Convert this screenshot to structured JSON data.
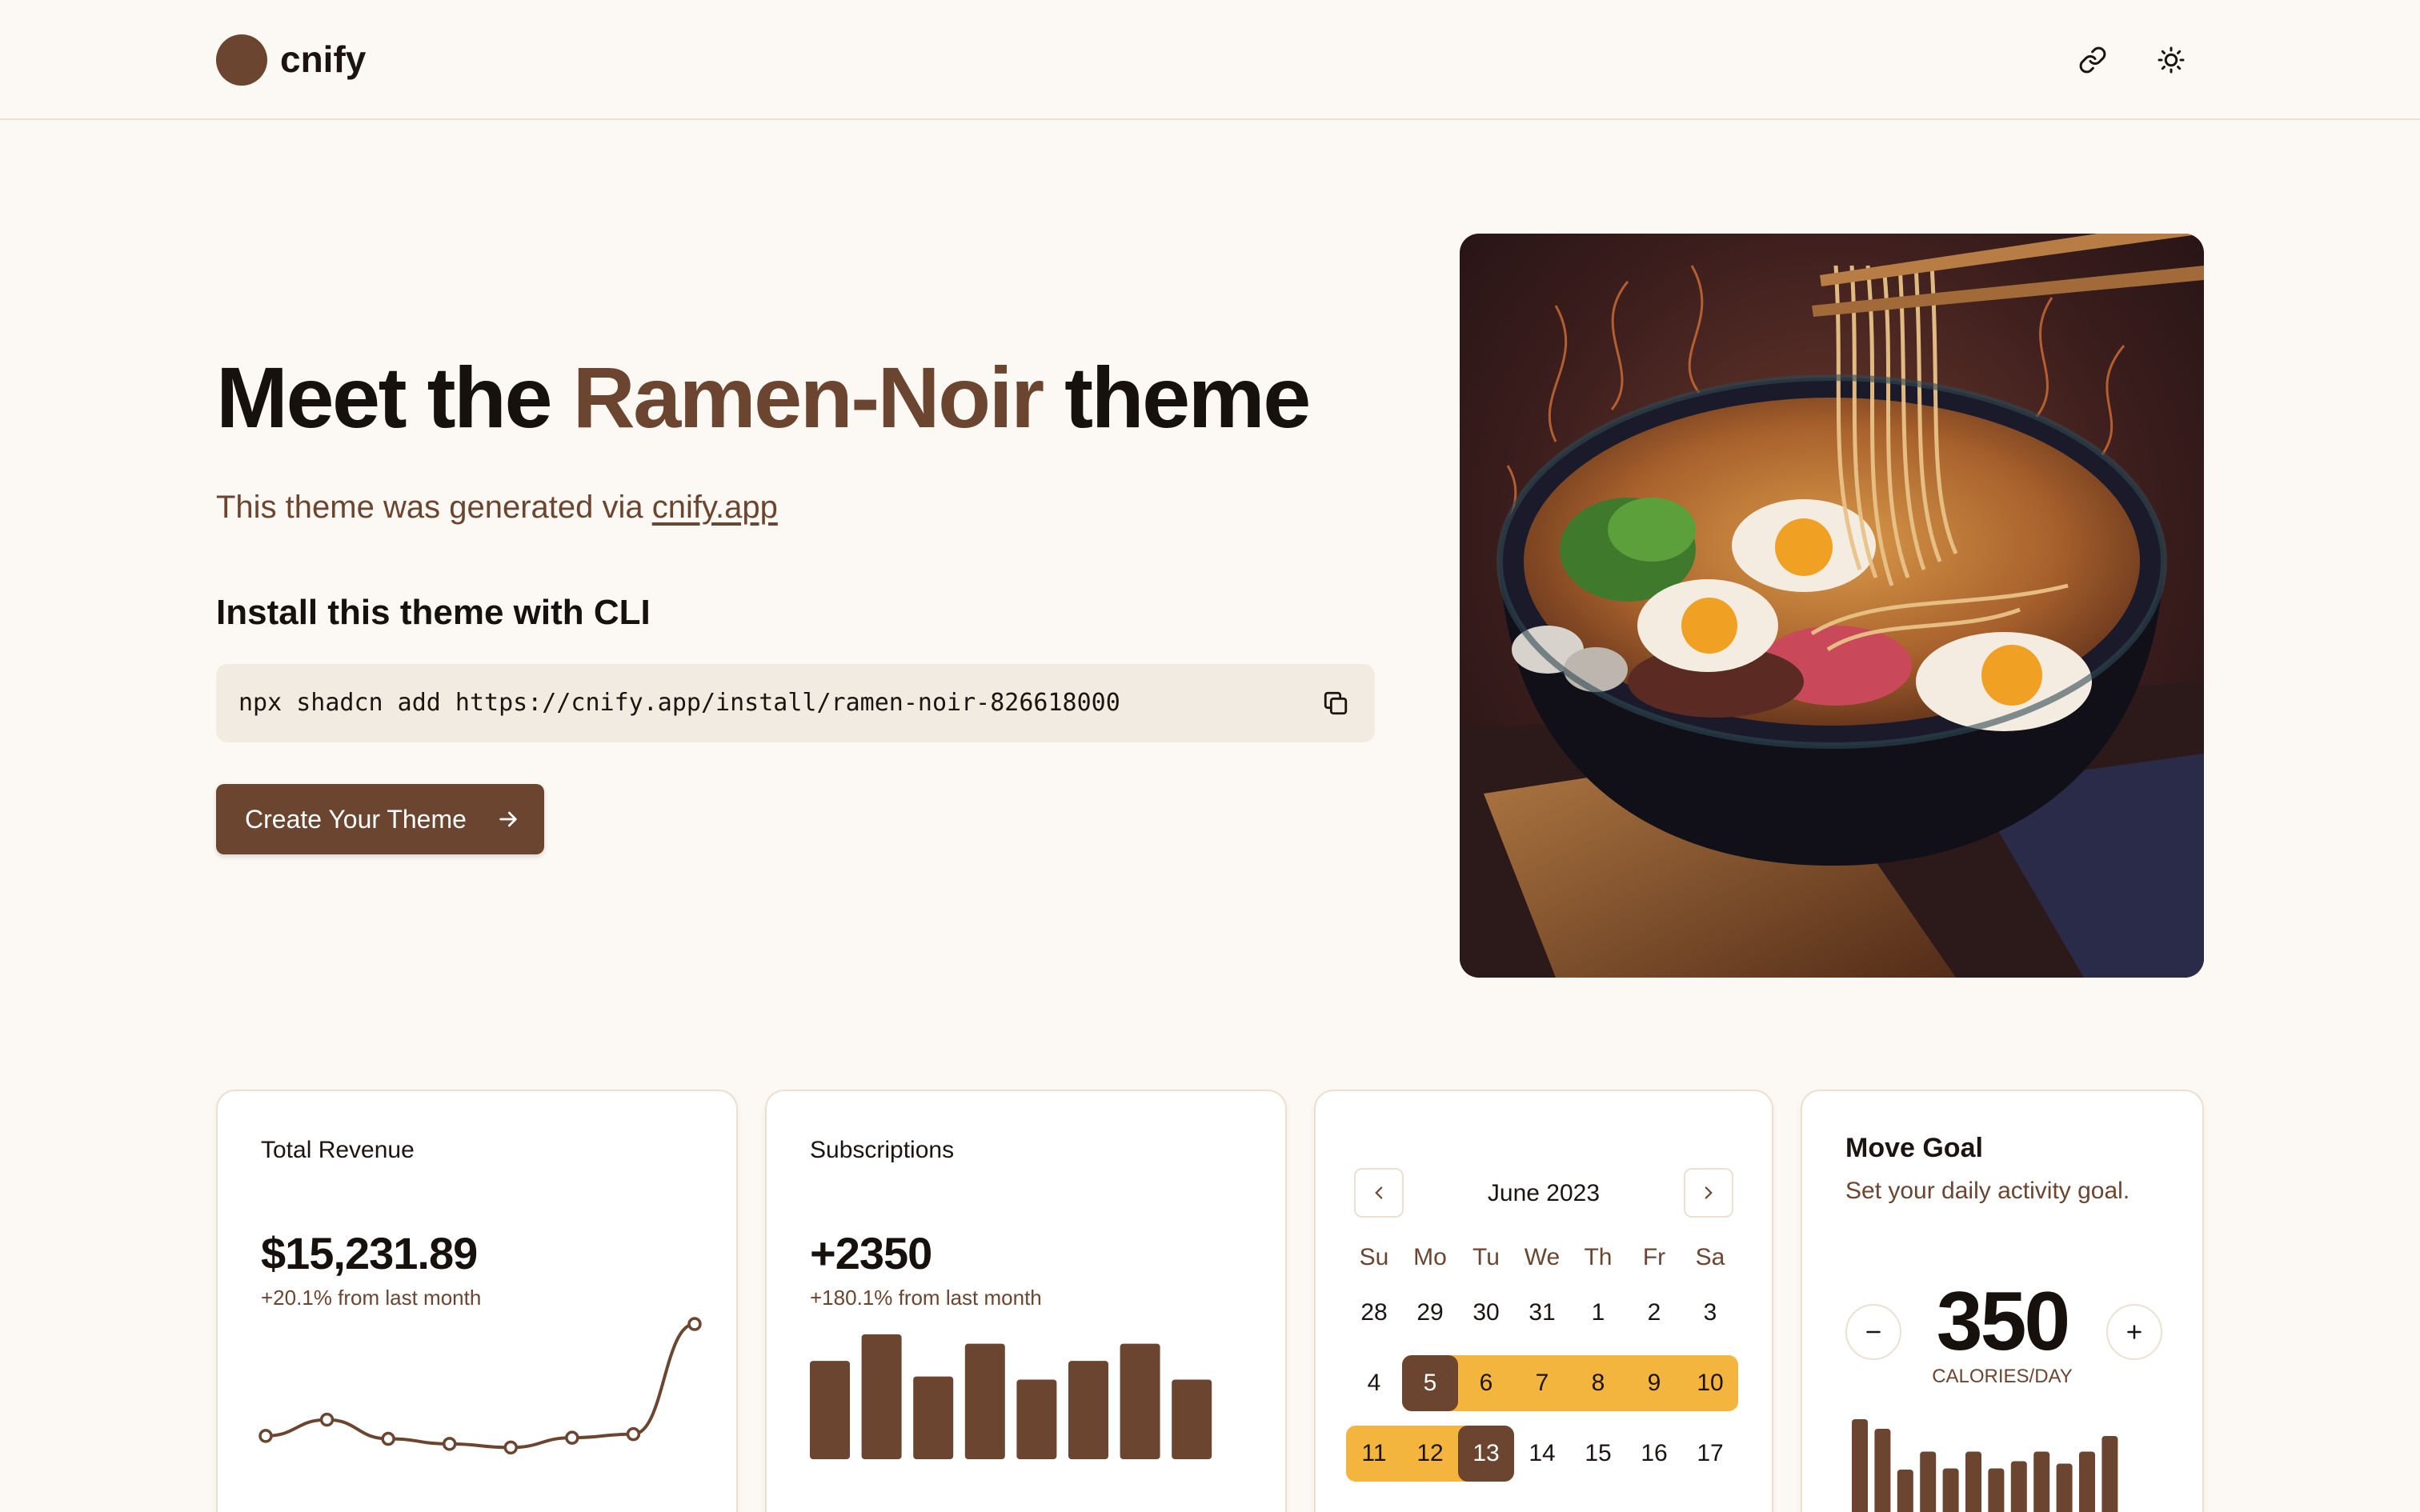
{
  "app": {
    "name": "cnify"
  },
  "header": {
    "link_icon": "link-icon",
    "theme_icon": "sun-icon"
  },
  "hero": {
    "title_prefix": "Meet the ",
    "title_accent": "Ramen-Noir",
    "title_suffix": " theme",
    "subtitle_prefix": "This theme was generated via ",
    "subtitle_link": "cnify.app",
    "install_title": "Install this theme with CLI",
    "command": "npx shadcn add https://cnify.app/install/ramen-noir-826618000",
    "cta_label": "Create Your Theme"
  },
  "colors": {
    "primary": "#6b4530",
    "accent": "#f4b53f",
    "background": "#fcf8f3"
  },
  "revenue": {
    "title": "Total Revenue",
    "value": "$15,231.89",
    "delta": "+20.1% from last month"
  },
  "subscriptions": {
    "title": "Subscriptions",
    "value": "+2350",
    "delta": "+180.1% from last month"
  },
  "calendar": {
    "month": "June 2023",
    "weekdays": [
      "Su",
      "Mo",
      "Tu",
      "We",
      "Th",
      "Fr",
      "Sa"
    ],
    "weeks": [
      [
        "28",
        "29",
        "30",
        "31",
        "1",
        "2",
        "3"
      ],
      [
        "4",
        "5",
        "6",
        "7",
        "8",
        "9",
        "10"
      ],
      [
        "11",
        "12",
        "13",
        "14",
        "15",
        "16",
        "17"
      ]
    ]
  },
  "move_goal": {
    "title": "Move Goal",
    "subtitle": "Set your daily activity goal.",
    "value": "350",
    "unit": "CALORIES/DAY"
  },
  "chart_data": [
    {
      "type": "line",
      "values": [
        0.3,
        0.75,
        0.22,
        0.08,
        -0.02,
        0.25,
        0.35,
        3.4
      ],
      "ylim": [
        -0.3,
        3.6
      ]
    },
    {
      "type": "bar",
      "values": [
        63,
        80,
        53,
        74,
        51,
        63,
        74,
        51
      ],
      "ylim": [
        0,
        82
      ]
    },
    {
      "type": "bar",
      "values": [
        100,
        92,
        58,
        73,
        59,
        73,
        59,
        65,
        73,
        63,
        73,
        86
      ],
      "ylim": [
        0,
        100
      ]
    }
  ]
}
